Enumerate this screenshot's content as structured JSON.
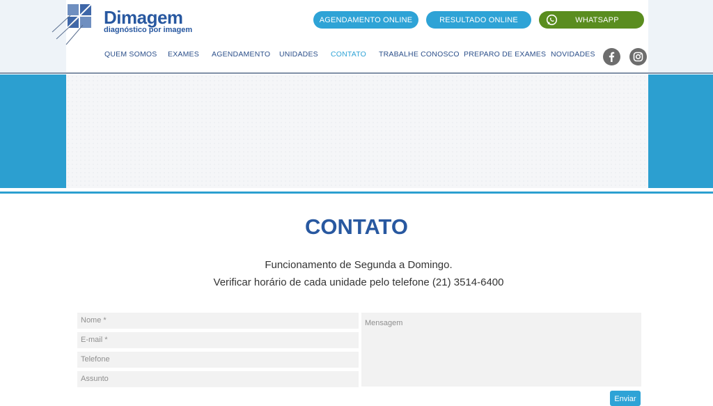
{
  "brand": {
    "name": "Dimagem",
    "tagline": "diagnóstico por imagem"
  },
  "header_buttons": {
    "agendamento": "AGENDAMENTO ONLINE",
    "resultado": "RESULTADO ONLINE",
    "whatsapp": "WHATSAPP"
  },
  "nav": {
    "items": [
      "QUEM SOMOS",
      "EXAMES",
      "AGENDAMENTO",
      "UNIDADES",
      "CONTATO",
      "TRABALHE CONOSCO",
      "PREPARO DE EXAMES",
      "NOVIDADES"
    ],
    "active": "CONTATO"
  },
  "social": {
    "facebook": "facebook-icon",
    "instagram": "instagram-icon"
  },
  "contact": {
    "title": "CONTATO",
    "hours": "Funcionamento de Segunda a Domingo.",
    "phone_note": "Verificar horário de cada unidade pelo telefone (21) 3514-6400"
  },
  "form": {
    "name_placeholder": "Nome *",
    "email_placeholder": "E-mail *",
    "phone_placeholder": "Telefone",
    "subject_placeholder": "Assunto",
    "message_placeholder": "Mensagem",
    "submit": "Enviar"
  },
  "colors": {
    "brand_blue": "#2858a0",
    "accent": "#2ea3d6",
    "whatsapp_green": "#5a8d1f"
  }
}
